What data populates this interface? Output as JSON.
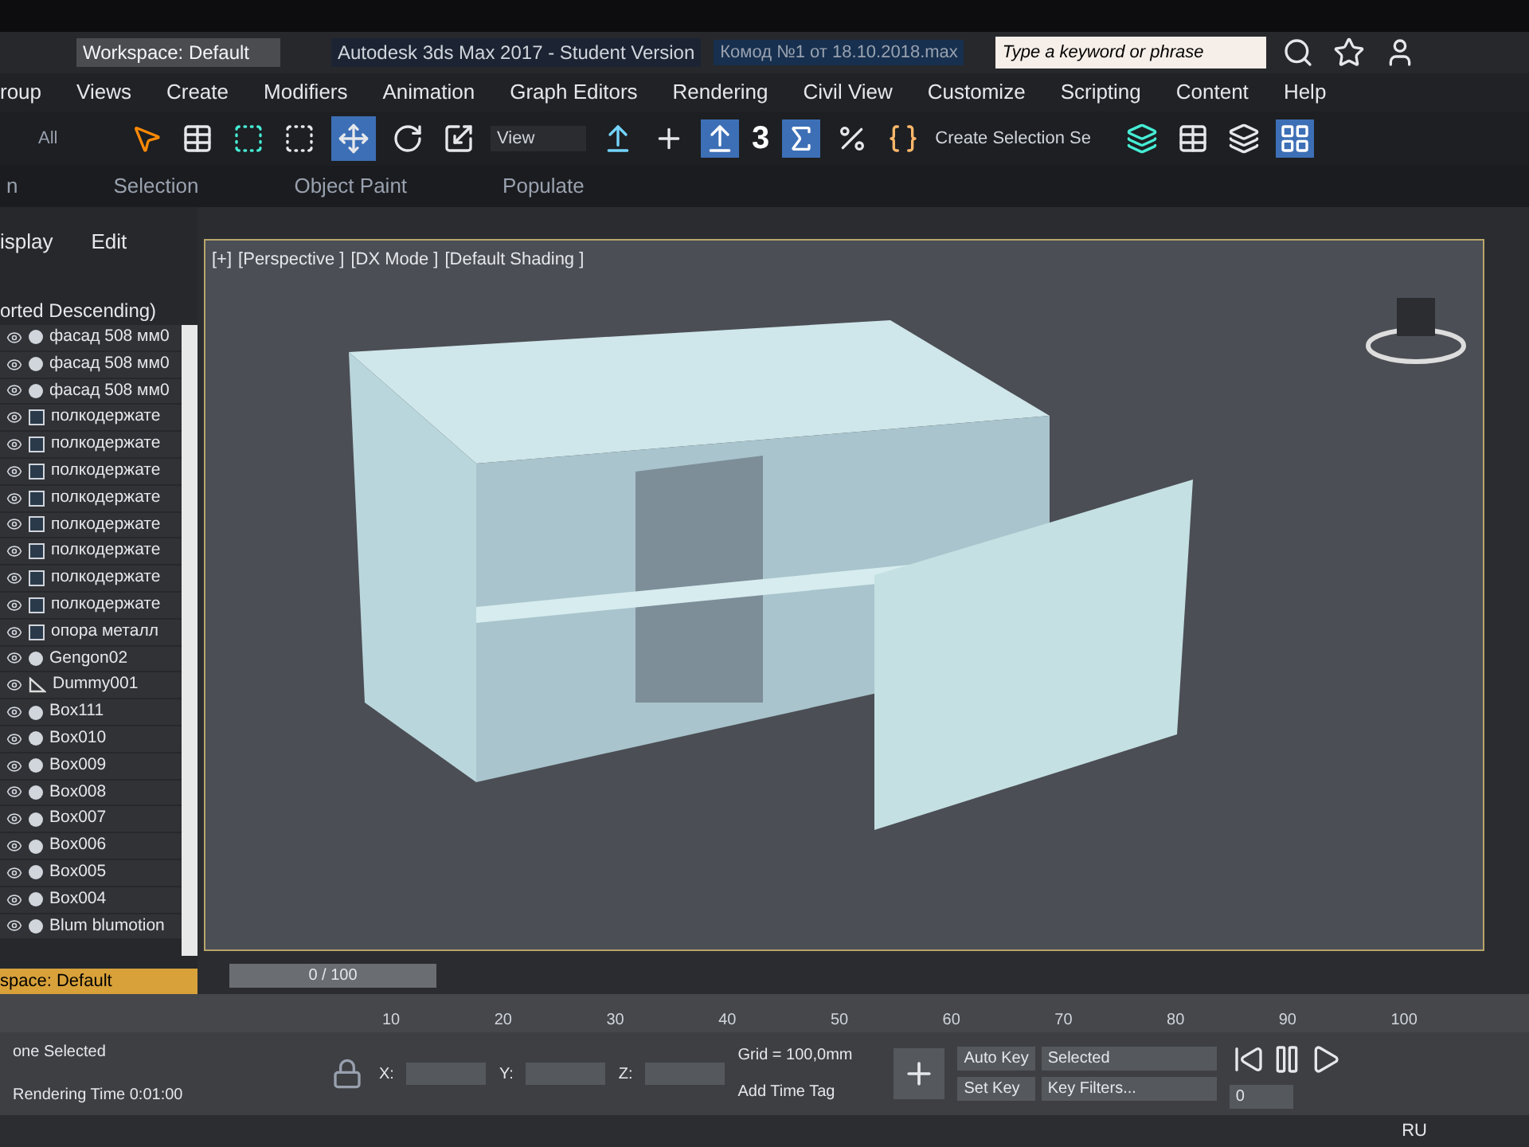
{
  "title_bar": {
    "workspace": "Workspace: Default",
    "app_title": "Autodesk 3ds Max 2017 - Student Version",
    "file_title": "Комод №1 от 18.10.2018.max",
    "search": {
      "placeholder": "Type a keyword or phrase"
    }
  },
  "menu": [
    "roup",
    "Views",
    "Create",
    "Modifiers",
    "Animation",
    "Graph Editors",
    "Rendering",
    "Civil View",
    "Customize",
    "Scripting",
    "Content",
    "Help"
  ],
  "toolbar": {
    "filter": "All",
    "reference_dropdown": "View",
    "snap_label": "3",
    "selection_set": "Create Selection Se"
  },
  "ribbon": [
    "n",
    "Selection",
    "Object Paint",
    "Populate"
  ],
  "explorer": {
    "tabs": [
      "isplay",
      "Edit"
    ],
    "header": "orted Descending)",
    "items": [
      {
        "kind": "geometry",
        "name": "фасад 508 мм0"
      },
      {
        "kind": "geometry",
        "name": "фасад 508 мм0"
      },
      {
        "kind": "geometry",
        "name": "фасад 508 мм0"
      },
      {
        "kind": "group",
        "name": "полкодержате"
      },
      {
        "kind": "group",
        "name": "полкодержате"
      },
      {
        "kind": "group",
        "name": "полкодержате"
      },
      {
        "kind": "group",
        "name": "полкодержате"
      },
      {
        "kind": "group",
        "name": "полкодержате"
      },
      {
        "kind": "group",
        "name": "полкодержате"
      },
      {
        "kind": "group",
        "name": "полкодержате"
      },
      {
        "kind": "group",
        "name": "полкодержате"
      },
      {
        "kind": "group",
        "name": "опора металл"
      },
      {
        "kind": "geometry",
        "name": "Gengon02"
      },
      {
        "kind": "helper",
        "name": "Dummy001"
      },
      {
        "kind": "geometry",
        "name": "Box111"
      },
      {
        "kind": "geometry",
        "name": "Box010"
      },
      {
        "kind": "geometry",
        "name": "Box009"
      },
      {
        "kind": "geometry",
        "name": "Box008"
      },
      {
        "kind": "geometry",
        "name": "Box007"
      },
      {
        "kind": "geometry",
        "name": "Box006"
      },
      {
        "kind": "geometry",
        "name": "Box005"
      },
      {
        "kind": "geometry",
        "name": "Box004"
      },
      {
        "kind": "geometry",
        "name": "Blum blumotion"
      }
    ],
    "workspace": "space: Default"
  },
  "viewport": {
    "labels": [
      "[+]",
      "[Perspective ]",
      "[DX Mode ]",
      "[Default Shading ]"
    ]
  },
  "timeline": {
    "frame": "0 / 100",
    "ticks": [
      "10",
      "20",
      "30",
      "40",
      "50",
      "60",
      "70",
      "80",
      "90",
      "100"
    ]
  },
  "status": {
    "selection": "one Selected",
    "render_time": "Rendering Time  0:01:00",
    "x_label": "X:",
    "y_label": "Y:",
    "z_label": "Z:",
    "grid": "Grid = 100,0mm",
    "add_time_tag": "Add Time Tag",
    "auto_key": "Auto Key",
    "key_mode": "Selected",
    "set_key": "Set Key",
    "key_filters": "Key Filters...",
    "frame_field": "0"
  },
  "taskbar": {
    "language": "RU"
  }
}
